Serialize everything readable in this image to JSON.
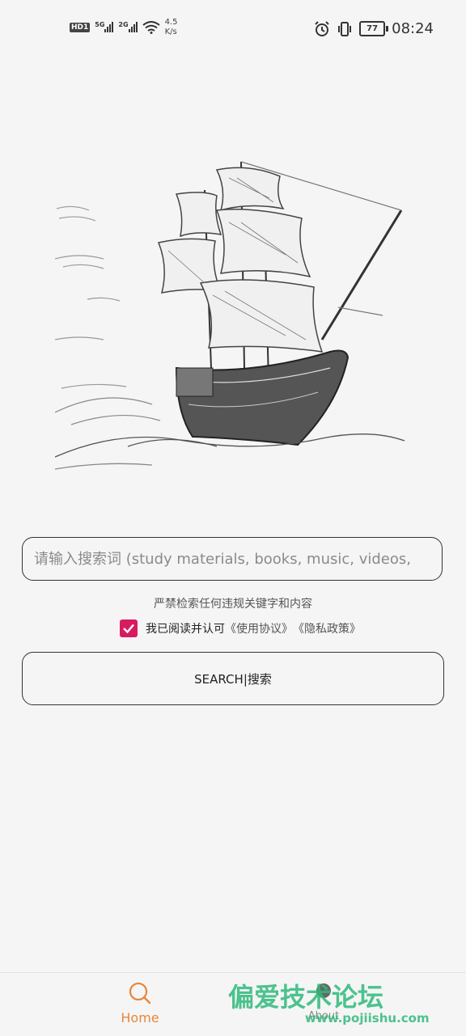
{
  "status_bar": {
    "hd": "HD",
    "sim1": "1",
    "net1": "5G",
    "net2": "2G",
    "speed_value": "4.5",
    "speed_unit": "K/s",
    "battery": "77",
    "time": "08:24"
  },
  "search": {
    "placeholder": "请输入搜索词 (study materials, books, music, videos,",
    "value": ""
  },
  "notice": "严禁检索任何违规关键字和内容",
  "agreement": {
    "checked": true,
    "text": "我已阅读并认可",
    "terms_link": "《使用协议》",
    "privacy_link": "《隐私政策》"
  },
  "search_button_label": "SEARCH|搜索",
  "bottom_nav": {
    "home_label": "Home",
    "about_label": "About"
  },
  "watermark": {
    "title": "偏爱技术论坛",
    "url": "www.pojiishu.com"
  },
  "colors": {
    "accent": "#e8863a",
    "checkbox": "#d81b60",
    "background": "#f5f5f5"
  }
}
